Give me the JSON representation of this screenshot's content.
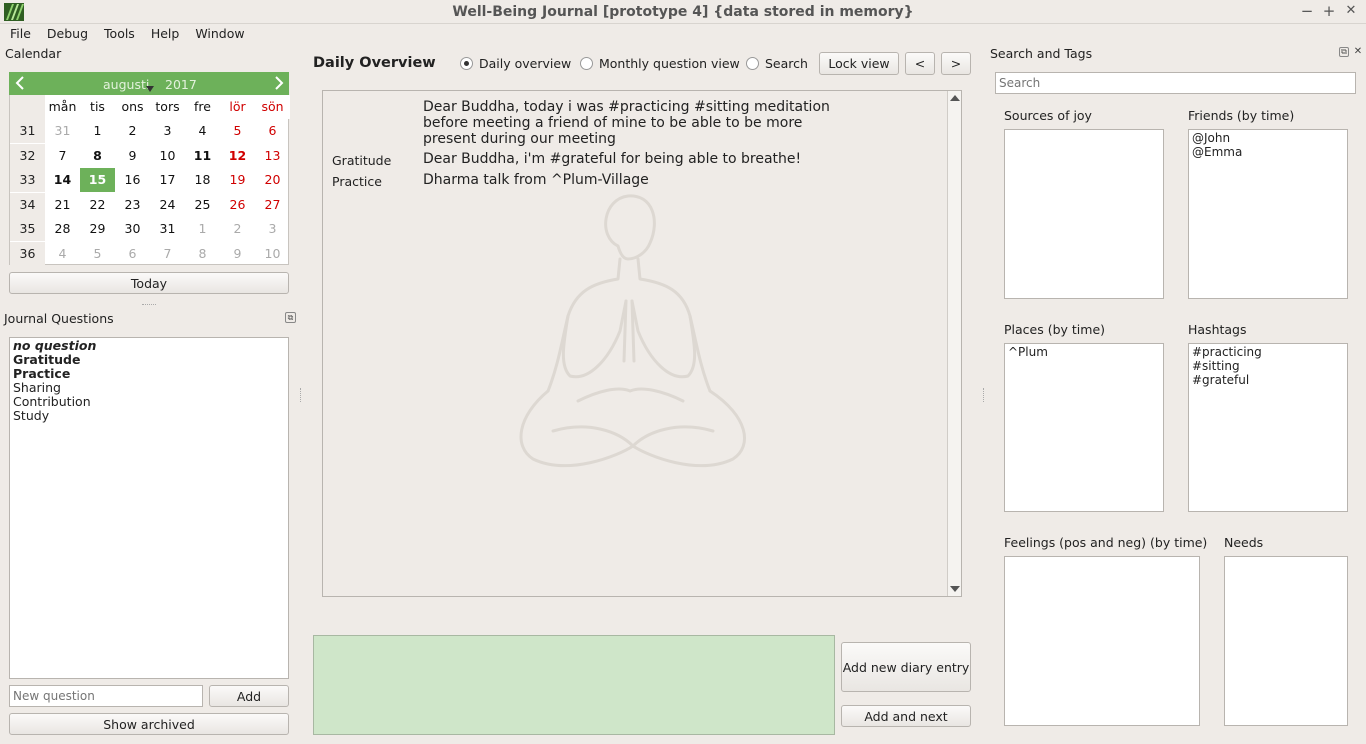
{
  "window": {
    "title": "Well-Being Journal [prototype 4] {data stored in memory}",
    "minimize": "−",
    "maximize": "+",
    "close": "✕"
  },
  "menu": [
    "File",
    "Debug",
    "Tools",
    "Help",
    "Window"
  ],
  "calendar": {
    "panel_title": "Calendar",
    "month": "augusti",
    "year": "2017",
    "day_headers": [
      "mån",
      "tis",
      "ons",
      "tors",
      "fre",
      "lör",
      "sön"
    ],
    "weeks": [
      {
        "wk": "31",
        "days": [
          "31",
          "1",
          "2",
          "3",
          "4",
          "5",
          "6"
        ]
      },
      {
        "wk": "32",
        "days": [
          "7",
          "8",
          "9",
          "10",
          "11",
          "12",
          "13"
        ]
      },
      {
        "wk": "33",
        "days": [
          "14",
          "15",
          "16",
          "17",
          "18",
          "19",
          "20"
        ]
      },
      {
        "wk": "34",
        "days": [
          "21",
          "22",
          "23",
          "24",
          "25",
          "26",
          "27"
        ]
      },
      {
        "wk": "35",
        "days": [
          "28",
          "29",
          "30",
          "31",
          "1",
          "2",
          "3"
        ]
      },
      {
        "wk": "36",
        "days": [
          "4",
          "5",
          "6",
          "7",
          "8",
          "9",
          "10"
        ]
      }
    ],
    "selected_day": "15",
    "today_button": "Today",
    "accent": "#6db15a"
  },
  "journal_questions": {
    "panel_title": "Journal Questions",
    "items": [
      {
        "label": "no question",
        "style": "bold-italic"
      },
      {
        "label": "Gratitude",
        "style": "bold"
      },
      {
        "label": "Practice",
        "style": "bold"
      },
      {
        "label": "Sharing",
        "style": "normal"
      },
      {
        "label": "Contribution",
        "style": "normal"
      },
      {
        "label": "Study",
        "style": "normal"
      }
    ],
    "new_question_placeholder": "New question",
    "add_button": "Add",
    "show_archived_button": "Show archived"
  },
  "overview": {
    "title": "Daily Overview",
    "view_options": [
      "Daily overview",
      "Monthly question view",
      "Search"
    ],
    "selected_view": "Daily overview",
    "lock_view": "Lock view",
    "prev": "<",
    "next": ">",
    "entries": [
      {
        "question": "",
        "text": "Dear Buddha, today i was #practicing #sitting meditation before meeting a friend of mine to be able to be more present during our meeting"
      },
      {
        "question": "Gratitude",
        "text": "Dear Buddha, i'm #grateful for being able to breathe!"
      },
      {
        "question": "Practice",
        "text": "Dharma talk from ^Plum-Village"
      }
    ],
    "add_new_button": "Add new diary entry",
    "add_and_next_button": "Add and next"
  },
  "search_tags": {
    "panel_title": "Search and Tags",
    "search_placeholder": "Search",
    "sources_of_joy": {
      "title": "Sources of joy",
      "items": []
    },
    "friends": {
      "title": "Friends (by time)",
      "items": [
        "@John",
        "@Emma"
      ]
    },
    "places": {
      "title": "Places (by time)",
      "items": [
        "^Plum"
      ]
    },
    "hashtags": {
      "title": "Hashtags",
      "items": [
        "#practicing",
        "#sitting",
        "#grateful"
      ]
    },
    "feelings": {
      "title": "Feelings (pos and neg) (by time)",
      "items": []
    },
    "needs": {
      "title": "Needs",
      "items": []
    }
  }
}
